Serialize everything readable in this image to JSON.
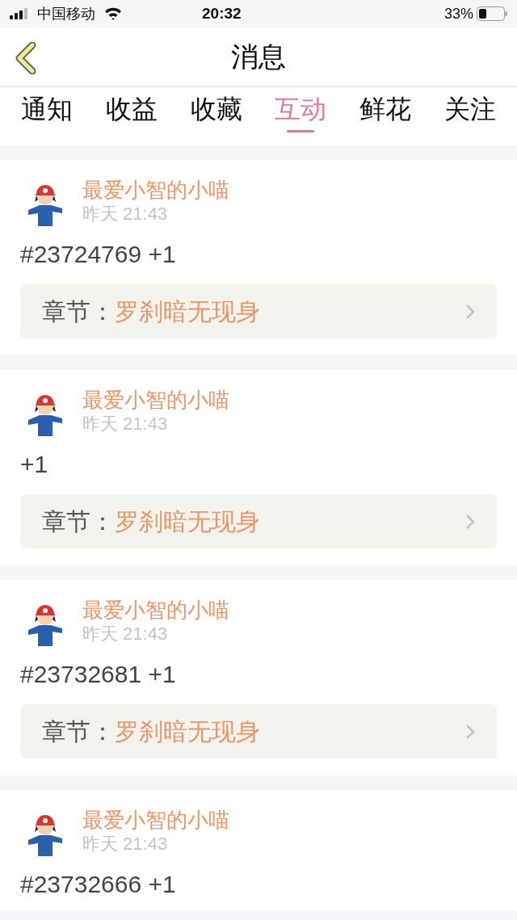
{
  "status_bar": {
    "carrier": "中国移动",
    "time": "20:32",
    "battery": "33%"
  },
  "header": {
    "title": "消息"
  },
  "tabs": [
    {
      "label": "通知",
      "selected": false
    },
    {
      "label": "收益",
      "selected": false
    },
    {
      "label": "收藏",
      "selected": false
    },
    {
      "label": "互动",
      "selected": true
    },
    {
      "label": "鲜花",
      "selected": false
    },
    {
      "label": "关注",
      "selected": false
    }
  ],
  "messages": [
    {
      "user": "最爱小智的小喵",
      "time": "昨天 21:43",
      "content": "#23724769 +1",
      "chapter_label": "章节：",
      "chapter": "罗刹暗无现身"
    },
    {
      "user": "最爱小智的小喵",
      "time": "昨天 21:43",
      "content": "+1",
      "chapter_label": "章节：",
      "chapter": "罗刹暗无现身"
    },
    {
      "user": "最爱小智的小喵",
      "time": "昨天 21:43",
      "content": "#23732681 +1",
      "chapter_label": "章节：",
      "chapter": "罗刹暗无现身"
    },
    {
      "user": "最爱小智的小喵",
      "time": "昨天 21:43",
      "content": "#23732666 +1"
    }
  ]
}
